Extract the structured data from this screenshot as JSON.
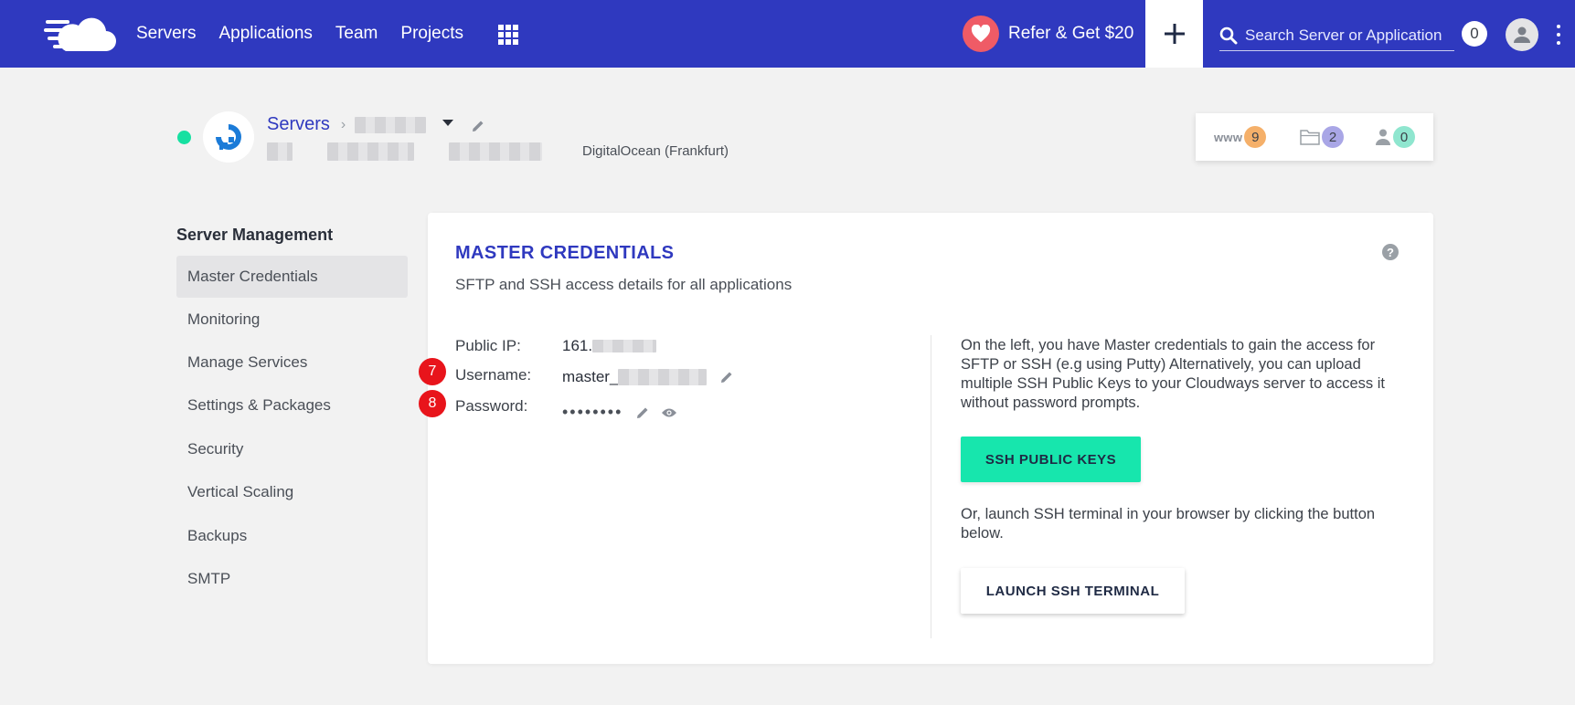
{
  "nav": {
    "items": [
      "Servers",
      "Applications",
      "Team",
      "Projects"
    ],
    "refer_label": "Refer & Get $20",
    "search_placeholder": "Search Server or Application",
    "notification_count": "0"
  },
  "server": {
    "breadcrumb_root": "Servers",
    "provider": "DigitalOcean (Frankfurt)",
    "stats": {
      "www_label": "www",
      "www_count": "9",
      "folder_count": "2",
      "users_count": "0"
    }
  },
  "sidebar": {
    "title": "Server Management",
    "items": [
      {
        "label": "Master Credentials",
        "active": true
      },
      {
        "label": "Monitoring"
      },
      {
        "label": "Manage Services"
      },
      {
        "label": "Settings & Packages"
      },
      {
        "label": "Security"
      },
      {
        "label": "Vertical Scaling"
      },
      {
        "label": "Backups"
      },
      {
        "label": "SMTP"
      }
    ]
  },
  "card": {
    "title": "MASTER CREDENTIALS",
    "subtitle": "SFTP and SSH access details for all applications",
    "help": "?",
    "public_ip_label": "Public IP:",
    "public_ip_value": "161.",
    "username_label": "Username:",
    "username_value": "master_",
    "password_label": "Password:",
    "password_value": "••••••••",
    "step_username": "7",
    "step_password": "8",
    "info_text": "On the left, you have Master credentials to gain the access for SFTP or SSH (e.g using Putty) Alternatively, you can upload multiple SSH Public Keys to your Cloudways server to access it without password prompts.",
    "ssh_keys_button": "SSH PUBLIC KEYS",
    "terminal_text": "Or, launch SSH terminal in your browser by clicking the button below.",
    "terminal_button": "LAUNCH SSH TERMINAL"
  },
  "colors": {
    "brand": "#2f39bf",
    "accent_green": "#17e6ad",
    "step_red": "#e8141b",
    "www_badge": "#f5b06a",
    "folder_badge": "#a9a6e6",
    "users_badge": "#8fe6cf"
  }
}
